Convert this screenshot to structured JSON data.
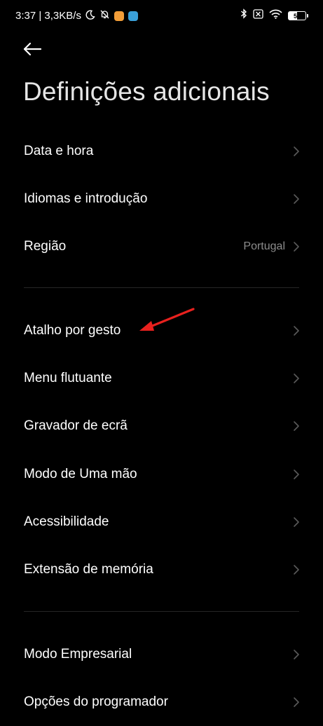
{
  "status_bar": {
    "time_speed": "3:37 | 3,3KB/s",
    "battery_level": "51",
    "icons": [
      "moon-icon",
      "bell-off-icon",
      "app-notification-icon",
      "app-notification-icon",
      "bluetooth-icon",
      "no-sim-icon",
      "wifi-icon",
      "battery-icon"
    ]
  },
  "header": {
    "title": "Definições adicionais"
  },
  "groups": {
    "general": [
      {
        "label": "Data e hora",
        "value": ""
      },
      {
        "label": "Idiomas e introdução",
        "value": ""
      },
      {
        "label": "Região",
        "value": "Portugal"
      }
    ],
    "features": [
      {
        "label": "Atalho por gesto"
      },
      {
        "label": "Menu flutuante"
      },
      {
        "label": "Gravador de ecrã"
      },
      {
        "label": "Modo de Uma mão"
      },
      {
        "label": "Acessibilidade"
      },
      {
        "label": "Extensão de memória"
      }
    ],
    "advanced": [
      {
        "label": "Modo Empresarial"
      },
      {
        "label": "Opções do programador"
      }
    ]
  },
  "colors": {
    "background": "#000000",
    "text": "#ffffff",
    "secondary_text": "#8c8c8c",
    "annotation_arrow": "#e8211e"
  }
}
